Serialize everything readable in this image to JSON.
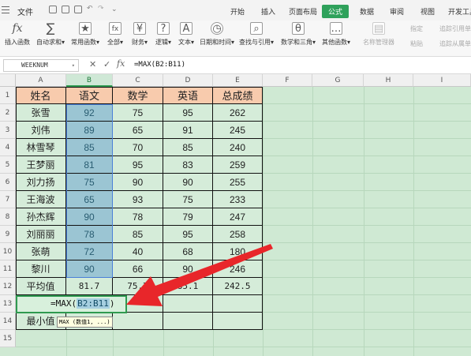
{
  "menubar": {
    "file_label": "文件",
    "tabs": [
      "开始",
      "插入",
      "页面布局",
      "公式",
      "数据",
      "审阅",
      "视图",
      "开发工具"
    ],
    "active_tab": "公式"
  },
  "ribbon": {
    "buttons": [
      {
        "label": "插入函数",
        "icon": "fx-icon"
      },
      {
        "label": "自动求和▾",
        "icon": "sigma-icon"
      },
      {
        "label": "常用函数▾",
        "icon": "star-function-icon"
      },
      {
        "label": "全部▾",
        "icon": "all-functions-icon"
      },
      {
        "label": "财务▾",
        "icon": "finance-icon"
      },
      {
        "label": "逻辑▾",
        "icon": "logic-icon"
      },
      {
        "label": "文本▾",
        "icon": "text-icon"
      },
      {
        "label": "日期和时间▾",
        "icon": "clock-icon"
      },
      {
        "label": "查找与引用▾",
        "icon": "lookup-icon"
      },
      {
        "label": "数学和三角▾",
        "icon": "math-icon"
      },
      {
        "label": "其他函数▾",
        "icon": "more-functions-icon"
      },
      {
        "label": "名称管理器",
        "icon": "name-manager-icon"
      }
    ],
    "small": [
      "指定",
      "粘贴",
      "追踪引用单元格",
      "追踪从属单元格"
    ]
  },
  "formula_bar": {
    "name_box": "WEEKNUM",
    "cancel_icon": "✕",
    "confirm_icon": "✓",
    "fx_label": "fx",
    "formula": "=MAX(B2:B11)"
  },
  "columns": [
    "A",
    "B",
    "C",
    "D",
    "E",
    "F",
    "G",
    "H",
    "I"
  ],
  "rows": [
    "1",
    "2",
    "3",
    "4",
    "5",
    "6",
    "7",
    "8",
    "9",
    "10",
    "11",
    "12",
    "13",
    "14",
    "15"
  ],
  "table": {
    "headers": [
      "姓名",
      "语文",
      "数学",
      "英语",
      "总成绩"
    ],
    "rows": [
      [
        "张雪",
        "92",
        "75",
        "95",
        "262"
      ],
      [
        "刘伟",
        "89",
        "65",
        "91",
        "245"
      ],
      [
        "林雪琴",
        "85",
        "70",
        "85",
        "240"
      ],
      [
        "王梦丽",
        "81",
        "95",
        "83",
        "259"
      ],
      [
        "刘力扬",
        "75",
        "90",
        "90",
        "255"
      ],
      [
        "王海波",
        "65",
        "93",
        "75",
        "233"
      ],
      [
        "孙杰辉",
        "90",
        "78",
        "79",
        "247"
      ],
      [
        "刘丽丽",
        "78",
        "85",
        "95",
        "258"
      ],
      [
        "张萌",
        "72",
        "40",
        "68",
        "180"
      ],
      [
        "黎川",
        "90",
        "66",
        "90",
        "246"
      ]
    ],
    "average": [
      "平均值",
      "81.7",
      "75.7",
      "85.1",
      "242.5"
    ],
    "row13_prefix": "=MAX(",
    "row13_ref": "B2:B11",
    "row13_suffix": ")",
    "row14_label": "最小值",
    "tooltip": "MAX (数值1, ...)"
  },
  "colors": {
    "header_fill": "#f8cbad",
    "data_fill": "#d5ecd9",
    "selected_fill": "#9bc5d3",
    "active_tab": "#2fa15b",
    "arrow": "#e8262a"
  }
}
